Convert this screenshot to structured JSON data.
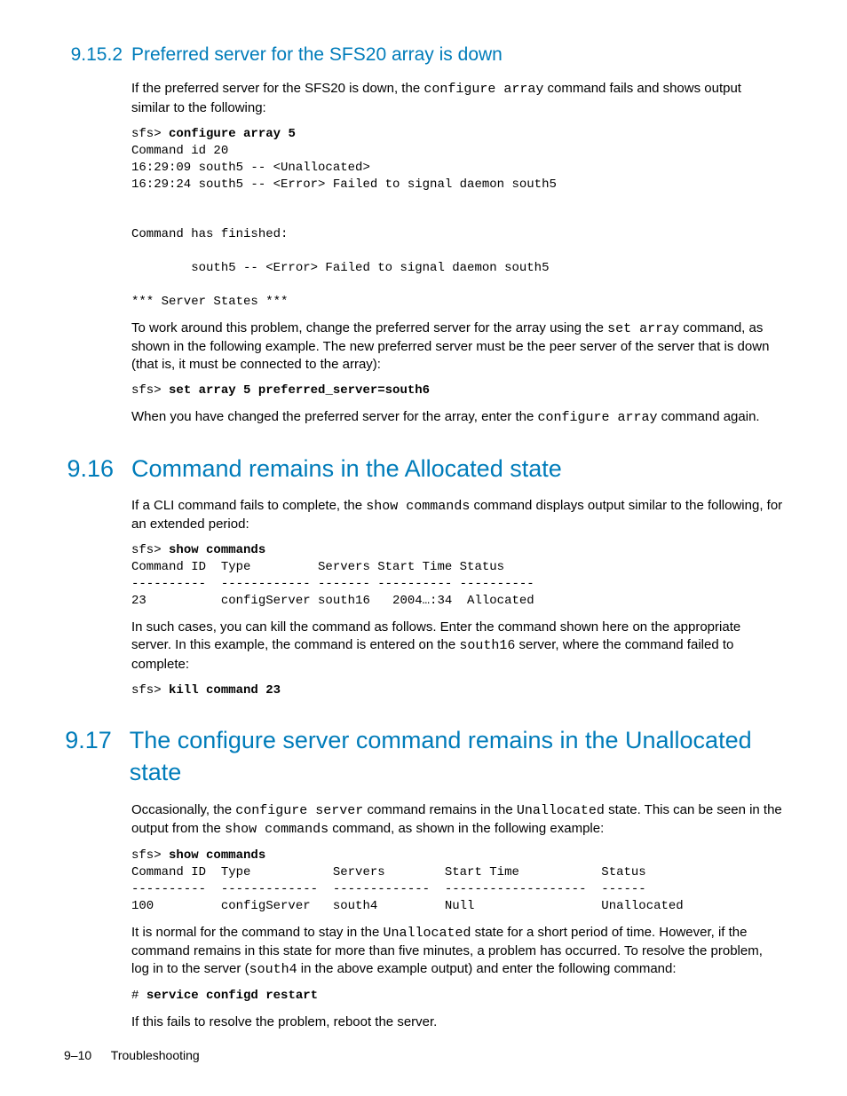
{
  "sec_9_15_2": {
    "num": "9.15.2",
    "title": "Preferred server for the SFS20 array is down",
    "p1_a": "If the preferred server for the SFS20 is down, the ",
    "p1_code": "configure array",
    "p1_b": " command fails and shows output similar to the following:",
    "code1_prompt": "sfs> ",
    "code1_cmd": "configure array 5",
    "code1_body": "Command id 20\n16:29:09 south5 -- <Unallocated>\n16:29:24 south5 -- <Error> Failed to signal daemon south5\n\n\nCommand has finished:\n\n        south5 -- <Error> Failed to signal daemon south5\n\n*** Server States ***",
    "p2_a": "To work around this problem, change the preferred server for the array using the ",
    "p2_code": "set array",
    "p2_b": " command, as shown in the following example. The new preferred server must be the peer server of the server that is down (that is, it must be connected to the array):",
    "code2_prompt": "sfs> ",
    "code2_cmd": "set array 5 preferred_server=south6",
    "p3_a": "When you have changed the preferred server for the array, enter the ",
    "p3_code": "configure array",
    "p3_b": " command again."
  },
  "sec_9_16": {
    "num": "9.16",
    "title": "Command remains in the Allocated state",
    "p1_a": "If a CLI command fails to complete, the ",
    "p1_code": "show commands",
    "p1_b": " command displays output similar to the following, for an extended period:",
    "code1_prompt": "sfs> ",
    "code1_cmd": "show commands",
    "code1_body": "\nCommand ID  Type         Servers Start Time Status\n----------  ------------ ------- ---------- ----------\n23          configServer south16   2004…:34  Allocated",
    "p2_a": "In such cases, you can kill the command as follows. Enter the command shown here on the appropriate server. In this example, the command is entered on the ",
    "p2_code": "south16",
    "p2_b": " server, where the command failed to complete:",
    "code2_prompt": "sfs> ",
    "code2_cmd": "kill command 23"
  },
  "sec_9_17": {
    "num": "9.17",
    "title": "The configure server command remains in the Unallocated state",
    "p1_a": "Occasionally, the ",
    "p1_code1": "configure server",
    "p1_b": " command remains in the ",
    "p1_code2": "Unallocated",
    "p1_c": " state. This can be seen in the output from the ",
    "p1_code3": "show commands",
    "p1_d": " command, as shown in the following example:",
    "code1_prompt": "sfs> ",
    "code1_cmd": "show commands",
    "code1_body": "\nCommand ID  Type           Servers        Start Time           Status\n----------  -------------  -------------  -------------------  ------\n100         configServer   south4         Null                 Unallocated",
    "p2_a": "It is normal for the command to stay in the ",
    "p2_code1": "Unallocated",
    "p2_b": " state for a short period of time. However, if the command remains in this state for more than five minutes, a problem has occurred. To resolve the problem, log in to the server (",
    "p2_code2": "south4",
    "p2_c": " in the above example output) and enter the following command:",
    "code2_prompt": "# ",
    "code2_cmd": "service configd restart",
    "p3": "If this fails to resolve the problem, reboot the server."
  },
  "footer": {
    "page": "9–10",
    "chapter": "Troubleshooting"
  }
}
